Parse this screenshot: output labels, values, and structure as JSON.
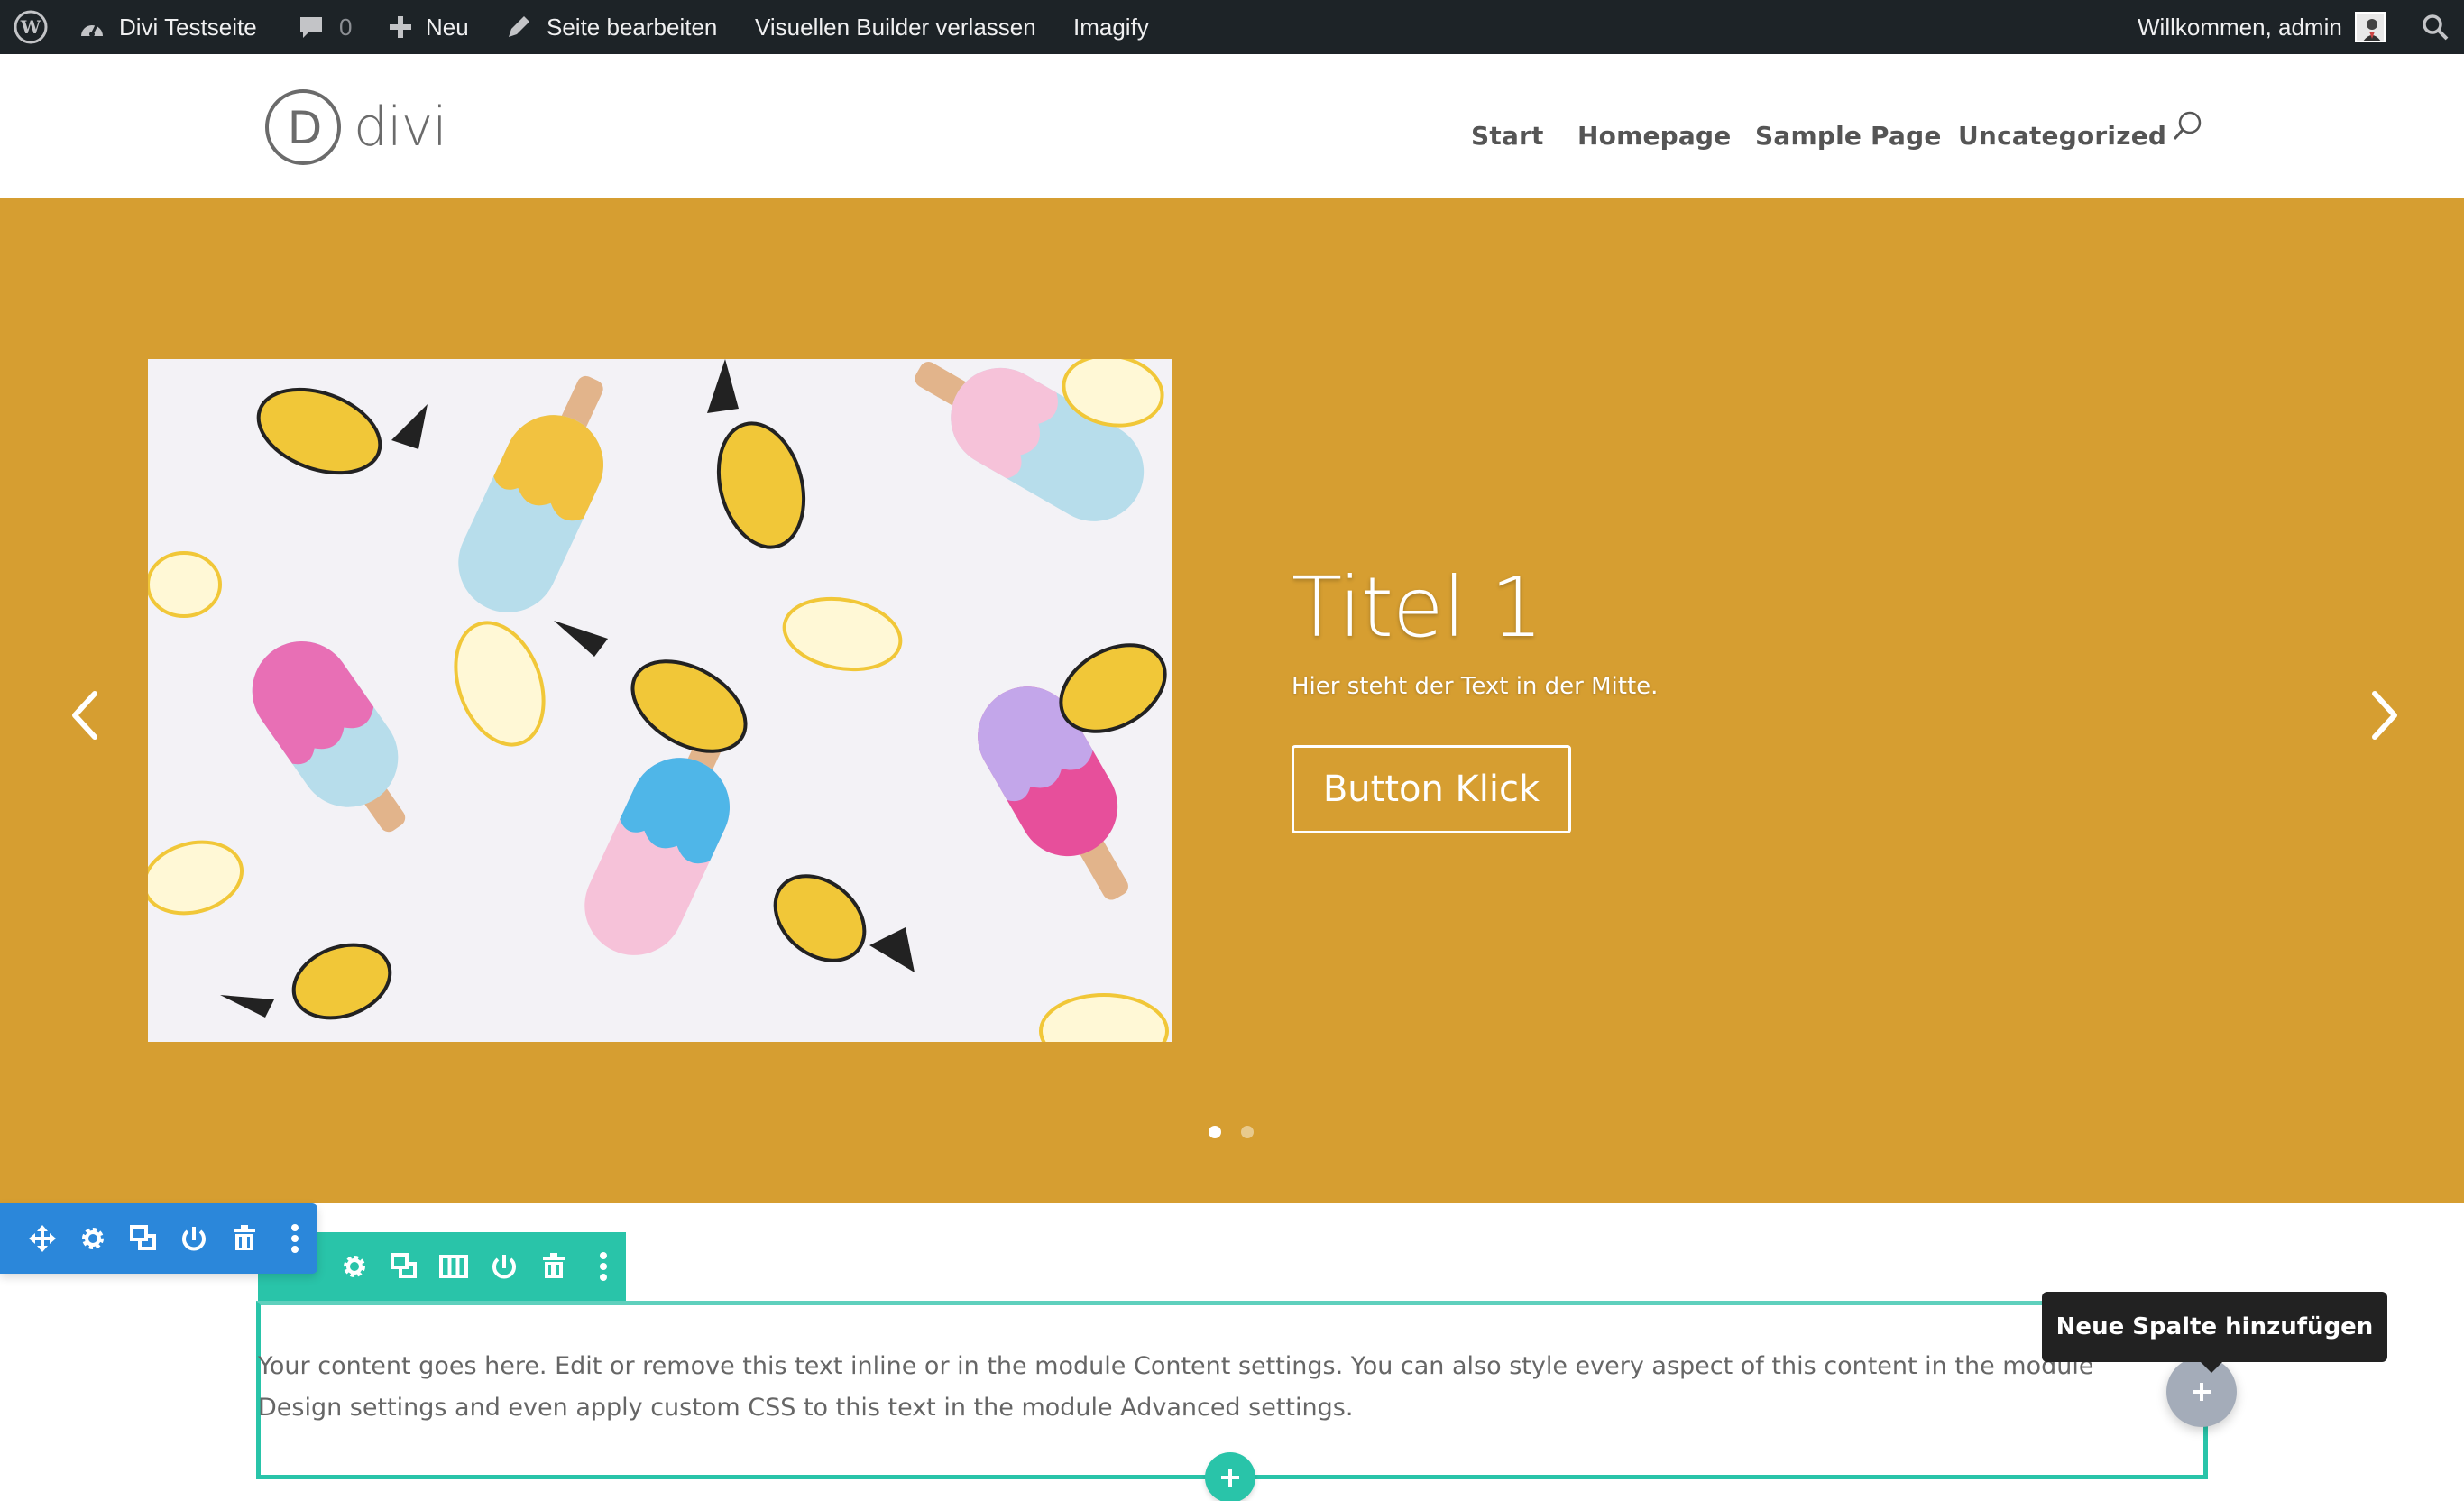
{
  "admin_bar": {
    "site_name": "Divi Testseite",
    "comments_count": "0",
    "new_label": "Neu",
    "edit_page": "Seite bearbeiten",
    "exit_builder": "Visuellen Builder verlassen",
    "imagify": "Imagify",
    "welcome": "Willkommen, admin",
    "icons": [
      "wordpress-logo",
      "dashboard",
      "comment",
      "plus",
      "pencil",
      "avatar",
      "search"
    ]
  },
  "header": {
    "logo_letter": "D",
    "logo_text": "divi",
    "nav": [
      "Start",
      "Homepage",
      "Sample Page",
      "Uncategorized"
    ]
  },
  "slider": {
    "title": "Titel 1",
    "text": "Hier steht der Text in der Mitte.",
    "button": "Button Klick",
    "active_slide": 1,
    "slide_count": 2,
    "background": "#d69e31"
  },
  "builder": {
    "section_toolbar_icons": [
      "move",
      "settings",
      "duplicate",
      "save",
      "delete",
      "more"
    ],
    "row_toolbar_icons": [
      "settings",
      "duplicate",
      "columns",
      "save",
      "delete",
      "more"
    ],
    "section_color": "#2b87da",
    "row_color": "#29c4a9",
    "body_text": "Your content goes here. Edit or remove this text inline or in the module Content settings. You can also style every aspect of this content in the module Design settings and even apply custom CSS to this text in the module Advanced settings.",
    "tooltip": "Neue Spalte hinzufügen"
  }
}
